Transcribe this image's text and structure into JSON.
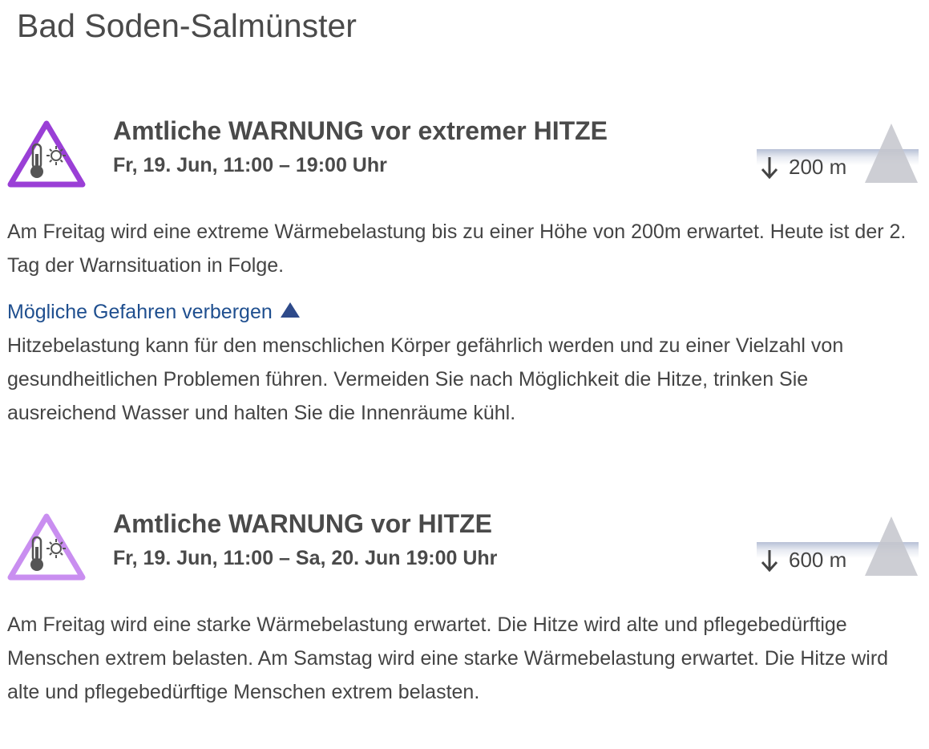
{
  "page": {
    "title": "Bad Soden-Salmünster"
  },
  "warnings": [
    {
      "icon": "heat-warning-icon",
      "color": "#9a3fd6",
      "title": "Amtliche WARNUNG vor extremer HITZE",
      "time": "Fr, 19. Jun, 11:00 – 19:00 Uhr",
      "altitude_label": "200 m",
      "text": "Am Freitag wird eine extreme Wärmebelastung bis zu einer Höhe von 200m erwartet. Heute ist der 2. Tag der Warnsituation in Folge.",
      "toggle_label": "Mögliche Gefahren verbergen",
      "dangers_text": "Hitzebelastung kann für den menschlichen Körper gefährlich werden und zu einer Vielzahl von gesundheitlichen Problemen führen. Vermeiden Sie nach Möglichkeit die Hitze, trinken Sie ausreichend Wasser und halten Sie die Innenräume kühl."
    },
    {
      "icon": "heat-warning-icon",
      "color": "#c98ef0",
      "title": "Amtliche WARNUNG vor HITZE",
      "time": "Fr, 19. Jun, 11:00 – Sa, 20. Jun 19:00 Uhr",
      "altitude_label": "600 m",
      "text": "Am Freitag wird eine starke Wärmebelastung erwartet. Die Hitze wird alte und pflegebedürftige Menschen extrem belasten. Am Samstag wird eine starke Wärmebelastung erwartet. Die Hitze wird alte und pflegebedürftige Menschen extrem belasten."
    }
  ]
}
